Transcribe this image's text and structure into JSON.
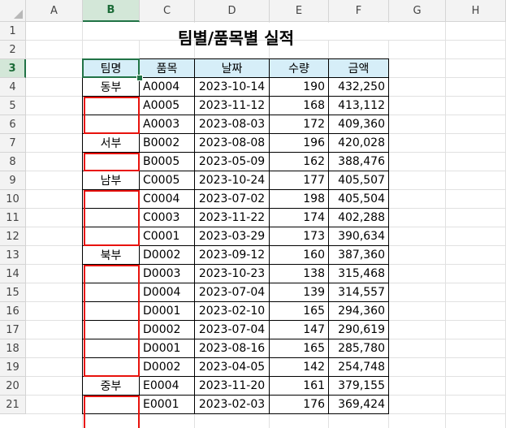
{
  "sheet": {
    "columns": [
      "A",
      "B",
      "C",
      "D",
      "E",
      "F",
      "G",
      "H"
    ],
    "selected_column": "B",
    "selected_row": "3",
    "rows": [
      "1",
      "2",
      "3",
      "4",
      "5",
      "6",
      "7",
      "8",
      "9",
      "10",
      "11",
      "12",
      "13",
      "14",
      "15",
      "16",
      "17",
      "18",
      "19",
      "20",
      "21"
    ],
    "title": "팀별/품목별 실적",
    "headers": [
      "팀명",
      "품목",
      "날짜",
      "수량",
      "금액"
    ],
    "records": [
      [
        "동부",
        "A0004",
        "2023-10-14",
        "190",
        "432,250"
      ],
      [
        "",
        "A0005",
        "2023-11-12",
        "168",
        "413,112"
      ],
      [
        "",
        "A0003",
        "2023-08-03",
        "172",
        "409,360"
      ],
      [
        "서부",
        "B0002",
        "2023-08-08",
        "196",
        "420,028"
      ],
      [
        "",
        "B0005",
        "2023-05-09",
        "162",
        "388,476"
      ],
      [
        "남부",
        "C0005",
        "2023-10-24",
        "177",
        "405,507"
      ],
      [
        "",
        "C0004",
        "2023-07-02",
        "198",
        "405,504"
      ],
      [
        "",
        "C0003",
        "2023-11-22",
        "174",
        "402,288"
      ],
      [
        "",
        "C0001",
        "2023-03-29",
        "173",
        "390,634"
      ],
      [
        "북부",
        "D0002",
        "2023-09-12",
        "160",
        "387,360"
      ],
      [
        "",
        "D0003",
        "2023-10-23",
        "138",
        "315,468"
      ],
      [
        "",
        "D0004",
        "2023-07-04",
        "139",
        "314,557"
      ],
      [
        "",
        "D0001",
        "2023-02-10",
        "165",
        "294,360"
      ],
      [
        "",
        "D0002",
        "2023-07-04",
        "147",
        "290,619"
      ],
      [
        "",
        "D0001",
        "2023-08-16",
        "165",
        "285,780"
      ],
      [
        "",
        "D0002",
        "2023-04-05",
        "142",
        "254,748"
      ],
      [
        "중부",
        "E0004",
        "2023-11-20",
        "161",
        "379,155"
      ],
      [
        "",
        "E0001",
        "2023-02-03",
        "176",
        "369,424"
      ]
    ]
  },
  "colors": {
    "header_fill": "#d6eef8",
    "highlight_border": "#e8120c",
    "selection": "#217346"
  }
}
